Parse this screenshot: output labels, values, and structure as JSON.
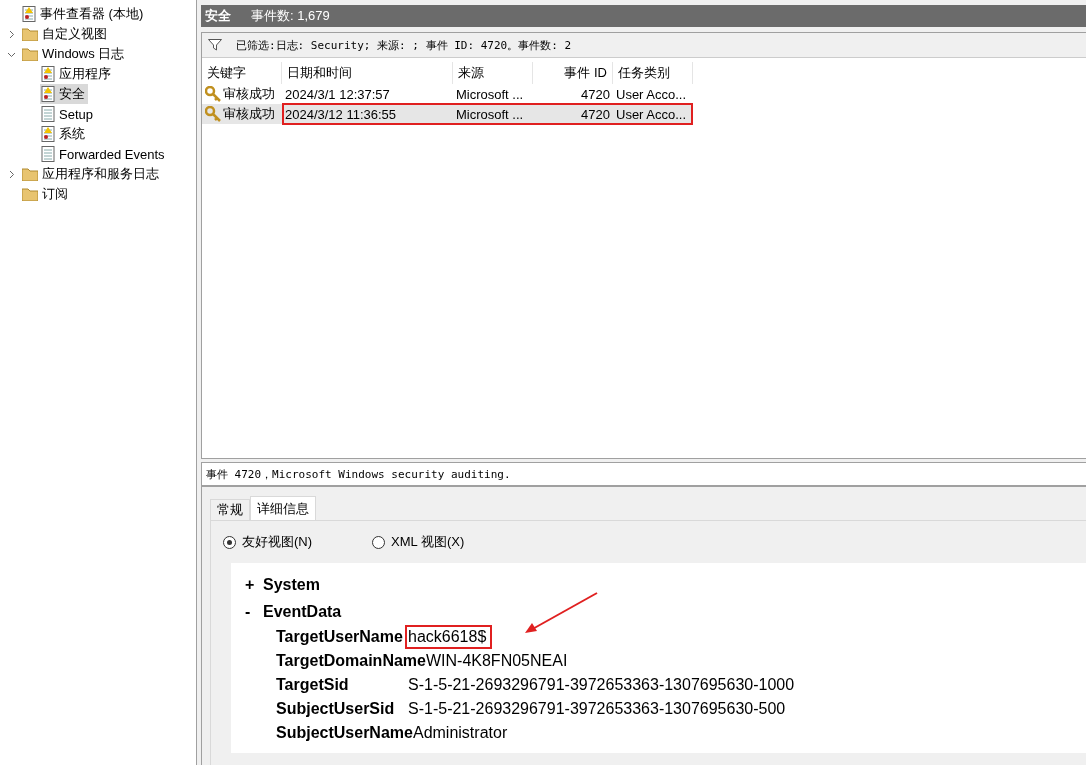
{
  "tree": [
    {
      "label": "事件查看器 (本地)",
      "kind": "root",
      "selected": false
    },
    {
      "label": "自定义视图",
      "kind": "folder",
      "expanded": false,
      "selected": false
    },
    {
      "label": "Windows 日志",
      "kind": "folder",
      "expanded": true,
      "selected": false,
      "children": [
        {
          "label": "应用程序",
          "kind": "log",
          "selected": false
        },
        {
          "label": "安全",
          "kind": "log",
          "selected": true
        },
        {
          "label": "Setup",
          "kind": "plainlog",
          "selected": false
        },
        {
          "label": "系统",
          "kind": "log",
          "selected": false
        },
        {
          "label": "Forwarded Events",
          "kind": "plainlog",
          "selected": false
        }
      ]
    },
    {
      "label": "应用程序和服务日志",
      "kind": "folder",
      "expanded": false,
      "selected": false
    },
    {
      "label": "订阅",
      "kind": "subs",
      "selected": false
    }
  ],
  "header": {
    "title": "安全",
    "count": "事件数: 1,679"
  },
  "filter": "已筛选:日志: Security; 来源: ; 事件 ID: 4720。事件数: 2",
  "table": {
    "columns": [
      "关键字",
      "日期和时间",
      "来源",
      "事件 ID",
      "任务类别"
    ],
    "rows": [
      {
        "cells": [
          "审核成功",
          "2024/3/1 12:37:57",
          "Microsoft ...",
          "4720",
          "User Acco..."
        ],
        "selected": false,
        "highlighted": false
      },
      {
        "cells": [
          "审核成功",
          "2024/3/12 11:36:55",
          "Microsoft ...",
          "4720",
          "User Acco..."
        ],
        "selected": true,
        "highlighted": true
      }
    ]
  },
  "preview": {
    "title": "事件 4720，Microsoft Windows security auditing.",
    "tabs": [
      {
        "label": "常规",
        "selected": false
      },
      {
        "label": "详细信息",
        "selected": true
      }
    ],
    "views": [
      {
        "label": "友好视图(N)",
        "selected": true
      },
      {
        "label": "XML 视图(X)",
        "selected": false
      }
    ],
    "sections": [
      {
        "sign": "+",
        "name": "System"
      },
      {
        "sign": "-",
        "name": "EventData"
      }
    ],
    "fields": [
      {
        "name": "TargetUserName",
        "value": "hack6618$",
        "highlighted": true
      },
      {
        "name": "TargetDomainName",
        "value": "WIN-4K8FN05NEAI",
        "highlighted": false
      },
      {
        "name": "TargetSid",
        "value": "S-1-5-21-2693296791-3972653363-1307695630-1000",
        "highlighted": false
      },
      {
        "name": "SubjectUserSid",
        "value": "S-1-5-21-2693296791-3972653363-1307695630-500",
        "highlighted": false
      },
      {
        "name": "SubjectUserName",
        "value": "Administrator",
        "highlighted": false
      }
    ]
  }
}
